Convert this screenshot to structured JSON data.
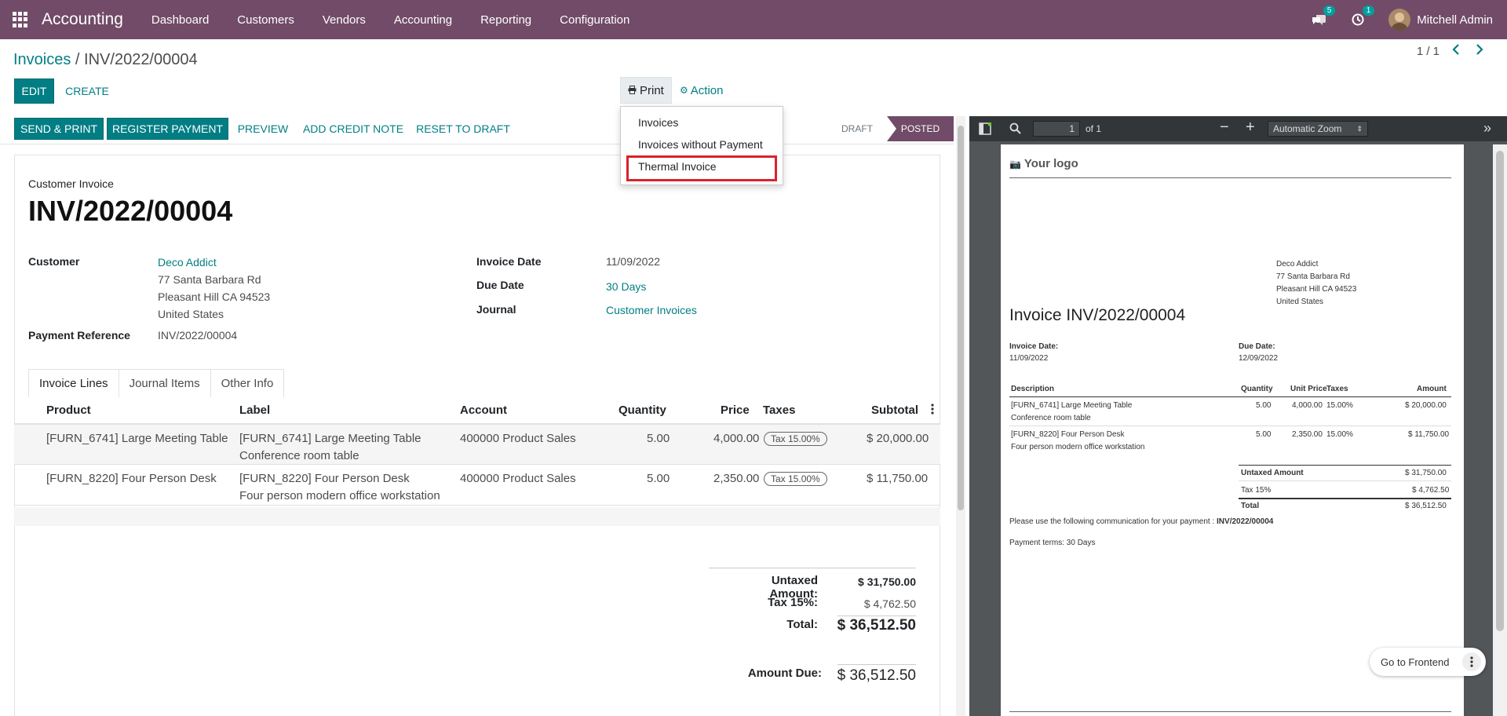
{
  "app": {
    "name": "Accounting"
  },
  "menu": [
    "Dashboard",
    "Customers",
    "Vendors",
    "Accounting",
    "Reporting",
    "Configuration"
  ],
  "systray": {
    "messages_count": "5",
    "activities_count": "1",
    "user": "Mitchell Admin"
  },
  "breadcrumb": {
    "parent": "Invoices",
    "sep": " / ",
    "current": "INV/2022/00004"
  },
  "buttons": {
    "edit": "EDIT",
    "create": "CREATE",
    "print": "Print",
    "action": "Action"
  },
  "pager": "1 / 1",
  "print_menu": [
    "Invoices",
    "Invoices without Payment",
    "Thermal Invoice"
  ],
  "status_buttons": [
    "SEND & PRINT",
    "REGISTER PAYMENT",
    "PREVIEW",
    "ADD CREDIT NOTE",
    "RESET TO DRAFT"
  ],
  "stages": {
    "draft": "DRAFT",
    "posted": "POSTED"
  },
  "invoice": {
    "type": "Customer Invoice",
    "number": "INV/2022/00004",
    "customer_label": "Customer",
    "customer_name": "Deco Addict",
    "addr1": "77 Santa Barbara Rd",
    "addr2": "Pleasant Hill CA 94523",
    "addr3": "United States",
    "payref_label": "Payment Reference",
    "payref": "INV/2022/00004",
    "date_label": "Invoice Date",
    "date": "11/09/2022",
    "due_label": "Due Date",
    "due": "30 Days",
    "journal_label": "Journal",
    "journal": "Customer Invoices"
  },
  "tabs": [
    "Invoice Lines",
    "Journal Items",
    "Other Info"
  ],
  "columns": {
    "product": "Product",
    "label": "Label",
    "account": "Account",
    "quantity": "Quantity",
    "price": "Price",
    "taxes": "Taxes",
    "subtotal": "Subtotal"
  },
  "lines": [
    {
      "product": "[FURN_6741] Large Meeting Table",
      "label1": "[FURN_6741] Large Meeting Table",
      "label2": "Conference room table",
      "account": "400000 Product Sales",
      "qty": "5.00",
      "price": "4,000.00",
      "tax": "Tax 15.00%",
      "subtotal": "$ 20,000.00"
    },
    {
      "product": "[FURN_8220] Four Person Desk",
      "label1": "[FURN_8220] Four Person Desk",
      "label2": "Four person modern office workstation",
      "account": "400000 Product Sales",
      "qty": "5.00",
      "price": "2,350.00",
      "tax": "Tax 15.00%",
      "subtotal": "$ 11,750.00"
    }
  ],
  "totals": {
    "untaxed_label": "Untaxed Amount:",
    "untaxed": "$ 31,750.00",
    "tax_label": "Tax 15%:",
    "tax": "$ 4,762.50",
    "total_label": "Total:",
    "total": "$ 36,512.50",
    "due_label": "Amount Due:",
    "due": "$ 36,512.50"
  },
  "pdf": {
    "page": "1",
    "of": "of 1",
    "zoom": "Automatic Zoom",
    "logo": "Your logo",
    "addr": [
      "Deco Addict",
      "77 Santa Barbara Rd",
      "Pleasant Hill CA 94523",
      "United States"
    ],
    "title": "Invoice INV/2022/00004",
    "date_label": "Invoice Date:",
    "date": "11/09/2022",
    "due_label": "Due Date:",
    "due": "12/09/2022",
    "cols": {
      "desc": "Description",
      "qty": "Quantity",
      "unit": "Unit Price",
      "taxes": "Taxes",
      "amount": "Amount"
    },
    "lines": [
      {
        "d1": "[FURN_6741] Large Meeting Table",
        "d2": "Conference room table",
        "qty": "5.00",
        "unit": "4,000.00",
        "tax": "15.00%",
        "amount": "$ 20,000.00"
      },
      {
        "d1": "[FURN_8220] Four Person Desk",
        "d2": "Four person modern office workstation",
        "qty": "5.00",
        "unit": "2,350.00",
        "tax": "15.00%",
        "amount": "$ 11,750.00"
      }
    ],
    "untaxed_label": "Untaxed Amount",
    "untaxed": "$ 31,750.00",
    "tax_label": "Tax 15%",
    "tax": "$ 4,762.50",
    "total_label": "Total",
    "total": "$ 36,512.50",
    "comm_text": "Please use the following communication for your payment :",
    "comm_ref": "INV/2022/00004",
    "terms": "Payment terms: 30 Days"
  },
  "frontend": "Go to Frontend",
  "colors": {
    "brand": "#714B67",
    "accent": "#017E84",
    "highlight": "#d9232c"
  }
}
